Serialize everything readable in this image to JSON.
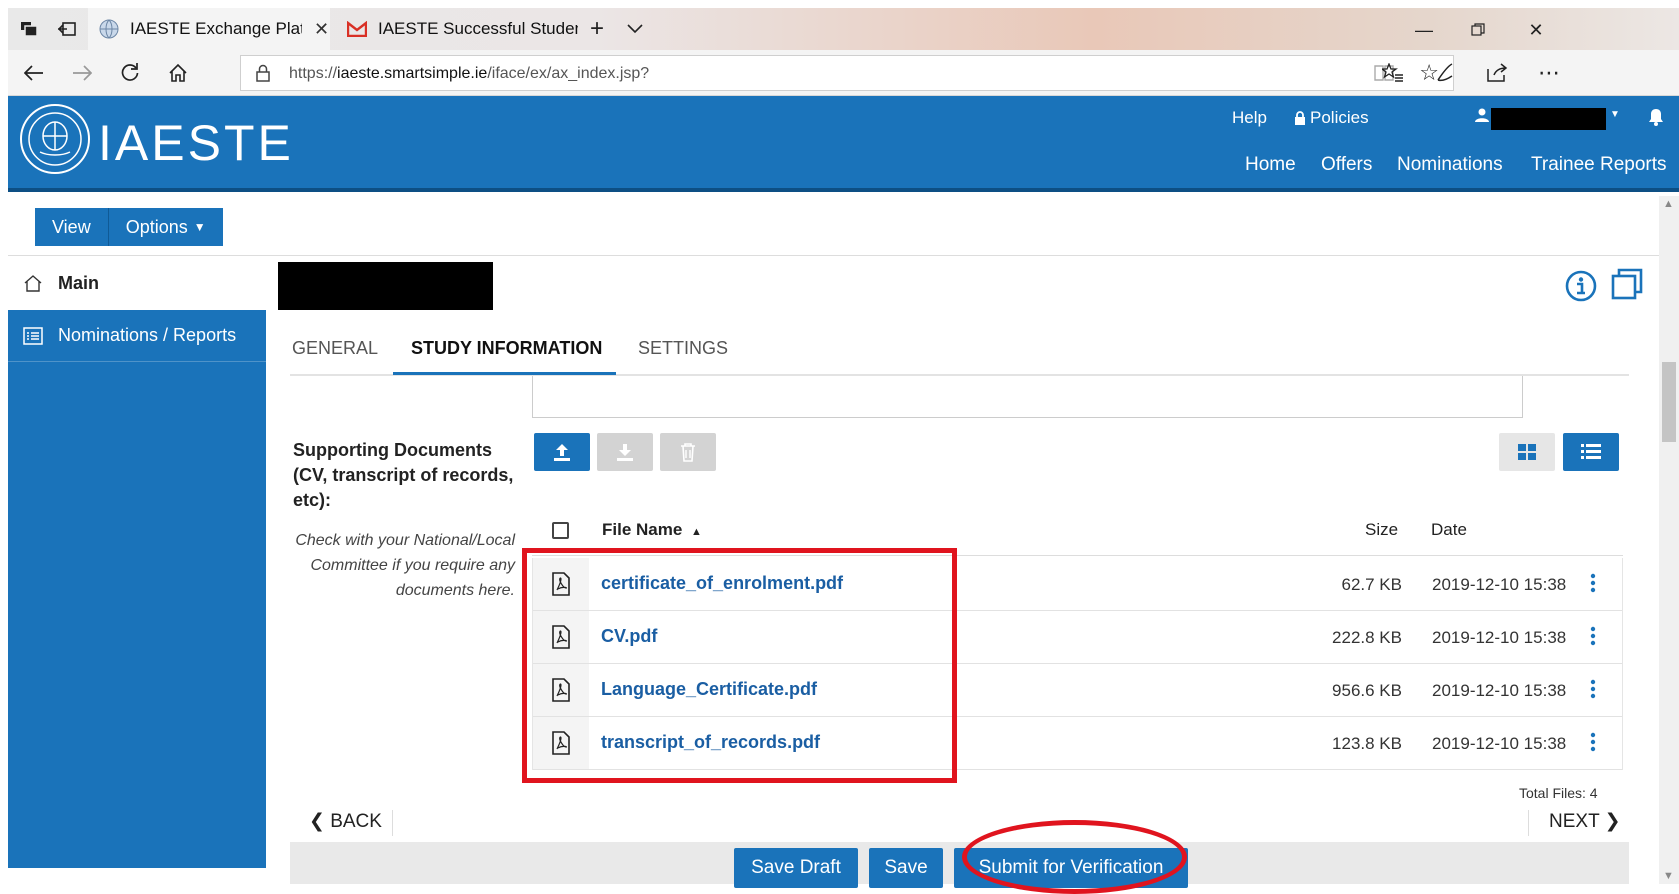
{
  "browser": {
    "tabs": [
      {
        "title": "IAESTE Exchange Platfo",
        "active": true
      },
      {
        "title": "IAESTE Successful Student F",
        "active": false
      }
    ],
    "url_prefix": "https://",
    "url_host": "iaeste.smartsimple.ie",
    "url_path": "/iface/ex/ax_index.jsp?"
  },
  "header": {
    "logo_text": "IAESTE",
    "util_links": {
      "help": "Help",
      "policies": "Policies"
    },
    "nav": [
      "Home",
      "Offers",
      "Nominations",
      "Trainee Reports"
    ]
  },
  "toolbar": {
    "view": "View",
    "options": "Options"
  },
  "sidebar": {
    "main": "Main",
    "items": [
      "Nominations / Reports"
    ]
  },
  "content_tabs": [
    "GENERAL",
    "STUDY INFORMATION",
    "SETTINGS"
  ],
  "documents": {
    "label": "Supporting Documents (CV, transcript of records, etc):",
    "help": "Check with your National/Local Committee if you require any documents here.",
    "columns": {
      "file": "File Name",
      "size": "Size",
      "date": "Date"
    },
    "files": [
      {
        "name": "certificate_of_enrolment.pdf",
        "size": "62.7 KB",
        "date": "2019-12-10 15:38"
      },
      {
        "name": "CV.pdf",
        "size": "222.8 KB",
        "date": "2019-12-10 15:38"
      },
      {
        "name": "Language_Certificate.pdf",
        "size": "956.6 KB",
        "date": "2019-12-10 15:38"
      },
      {
        "name": "transcript_of_records.pdf",
        "size": "123.8 KB",
        "date": "2019-12-10 15:38"
      }
    ],
    "total": "Total Files: 4"
  },
  "pager": {
    "back": "BACK",
    "next": "NEXT"
  },
  "actions": {
    "save_draft": "Save Draft",
    "save": "Save",
    "submit": "Submit for Verification"
  },
  "colors": {
    "brand": "#1a73ba",
    "annotation": "#e0141e"
  }
}
